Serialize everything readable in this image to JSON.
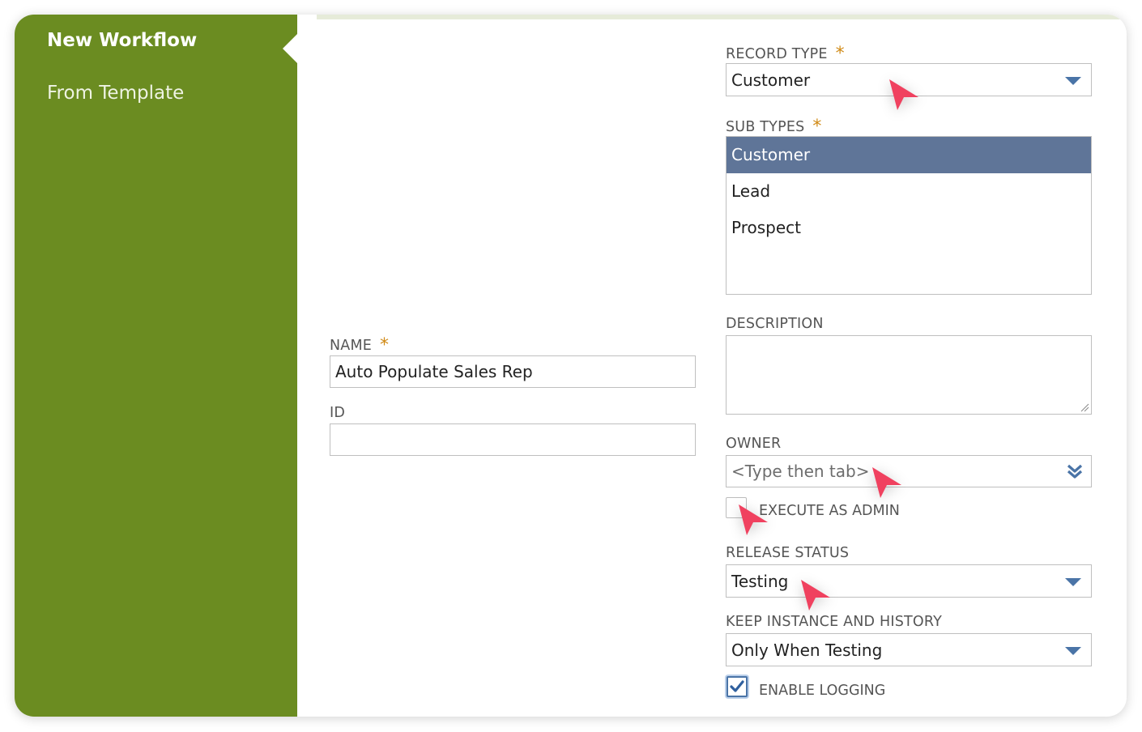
{
  "sidebar": {
    "active_label": "New Workflow",
    "items": [
      {
        "label": "From Template"
      }
    ],
    "accent_color": "#6b8c21"
  },
  "form": {
    "required_marker": "*",
    "name": {
      "label": "NAME",
      "value": "Auto Populate Sales Rep"
    },
    "id": {
      "label": "ID",
      "value": ""
    },
    "record_type": {
      "label": "RECORD TYPE",
      "value": "Customer"
    },
    "sub_types": {
      "label": "SUB TYPES",
      "options": [
        {
          "label": "Customer",
          "selected": true
        },
        {
          "label": "Lead",
          "selected": false
        },
        {
          "label": "Prospect",
          "selected": false
        }
      ]
    },
    "description": {
      "label": "DESCRIPTION",
      "value": ""
    },
    "owner": {
      "label": "OWNER",
      "placeholder": "<Type then tab>"
    },
    "execute_as_admin": {
      "label": "EXECUTE AS ADMIN",
      "checked": false
    },
    "release_status": {
      "label": "RELEASE STATUS",
      "value": "Testing"
    },
    "keep_instance": {
      "label": "KEEP INSTANCE AND HISTORY",
      "value": "Only When Testing"
    },
    "enable_logging": {
      "label": "ENABLE LOGGING",
      "checked": true
    }
  },
  "colors": {
    "selection": "#5f7598",
    "dropdown_arrow": "#4a74a7",
    "required": "#d08a16",
    "cursor": "#f0415f"
  }
}
